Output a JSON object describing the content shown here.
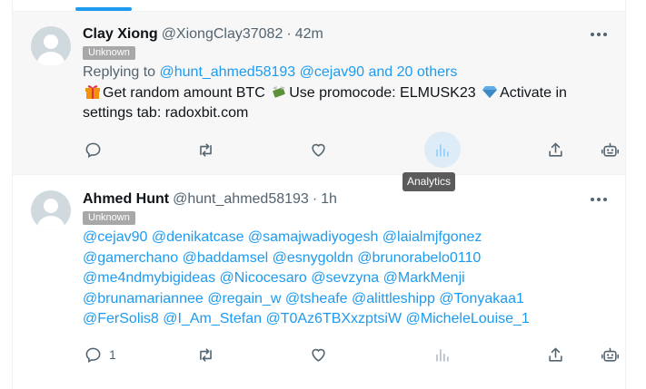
{
  "tweets": [
    {
      "display_name": "Clay Xiong",
      "handle": "@XiongClay37082",
      "separator": "·",
      "time": "42m",
      "badge": "Unknown",
      "replying_label": "Replying to",
      "replying_to": "@hunt_ahmed58193 @cejav90 and 20 others",
      "text_parts": [
        "Get random amount BTC",
        "Use promocode: ELMUSK23",
        "Activate in settings tab: radoxbit.com"
      ],
      "emoji": [
        "gift-emoji",
        "money-with-wings-emoji",
        "gem-emoji"
      ],
      "reply_count": "",
      "highlighted_action": "analytics"
    },
    {
      "display_name": "Ahmed Hunt",
      "handle": "@hunt_ahmed58193",
      "separator": "·",
      "time": "1h",
      "badge": "Unknown",
      "mention_lines": [
        "@cejav90 @denikatcase @samajwadiyogesh @laialmjfgonez",
        "@gamerchano @baddamsel @esnygoldn @brunorabelo0110",
        "@me4ndmybigideas @Nicocesaro @sevzyna @MarkMenji",
        "@brunamariannee @regain_w @tsheafe @alittleshipp @Tonyakaa1",
        "@FerSolis8 @I_Am_Stefan @T0Az6TBXxzptsiW @MicheleLouise_1"
      ],
      "reply_count": "1"
    }
  ],
  "tooltip": "Analytics",
  "icons": {
    "reply": "reply-icon",
    "retweet": "retweet-icon",
    "like": "like-icon",
    "analytics": "analytics-icon",
    "share": "share-icon",
    "bot": "bot-icon",
    "more": "more-icon"
  },
  "colors": {
    "accent": "#1d9bf0",
    "muted": "#536471",
    "badge": "#a8a8a8",
    "hover_bg": "#f7f7f7"
  }
}
